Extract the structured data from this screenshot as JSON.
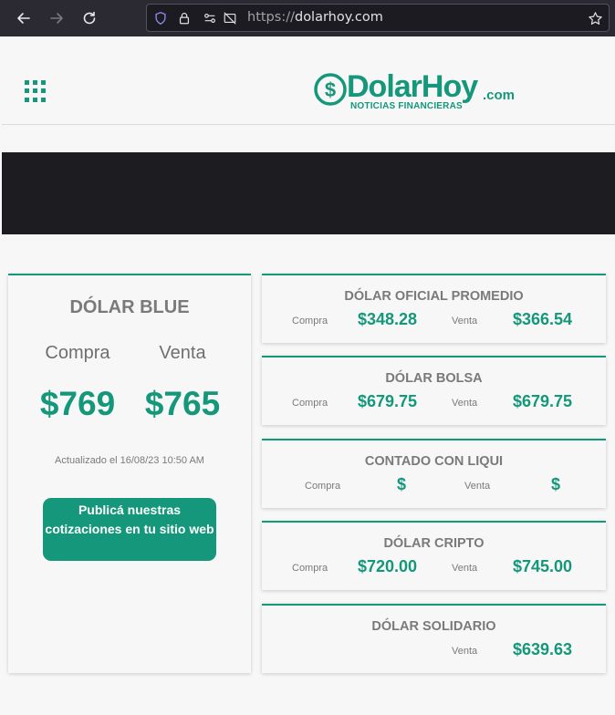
{
  "browser": {
    "url_scheme": "https://",
    "url_host": "dolarhoy.com"
  },
  "site": {
    "logo_brand": "DolarHoy",
    "logo_suffix": ".com",
    "logo_tagline": "NOTICIAS FINANCIERAS"
  },
  "blue": {
    "title": "DÓLAR BLUE",
    "buy_label": "Compra",
    "sell_label": "Venta",
    "buy_value": "$769",
    "sell_value": "$765",
    "updated": "Actualizado el 16/08/23 10:50 AM",
    "publish_button": "Publicá nuestras cotizaciones en tu sitio web"
  },
  "quotes": [
    {
      "title": "DÓLAR OFICIAL PROMEDIO",
      "buy_label": "Compra",
      "buy": "$348.28",
      "sell_label": "Venta",
      "sell": "$366.54"
    },
    {
      "title": "DÓLAR BOLSA",
      "buy_label": "Compra",
      "buy": "$679.75",
      "sell_label": "Venta",
      "sell": "$679.75"
    },
    {
      "title": "CONTADO CON LIQUI",
      "buy_label": "Compra",
      "buy": "$",
      "sell_label": "Venta",
      "sell": "$"
    },
    {
      "title": "DÓLAR CRIPTO",
      "buy_label": "Compra",
      "buy": "$720.00",
      "sell_label": "Venta",
      "sell": "$745.00"
    },
    {
      "title": "DÓLAR SOLIDARIO",
      "sell_label": "Venta",
      "sell": "$639.63"
    }
  ],
  "colors": {
    "accent": "#14977a",
    "banner": "#1c1c21",
    "chrome": "#2b2a33"
  }
}
